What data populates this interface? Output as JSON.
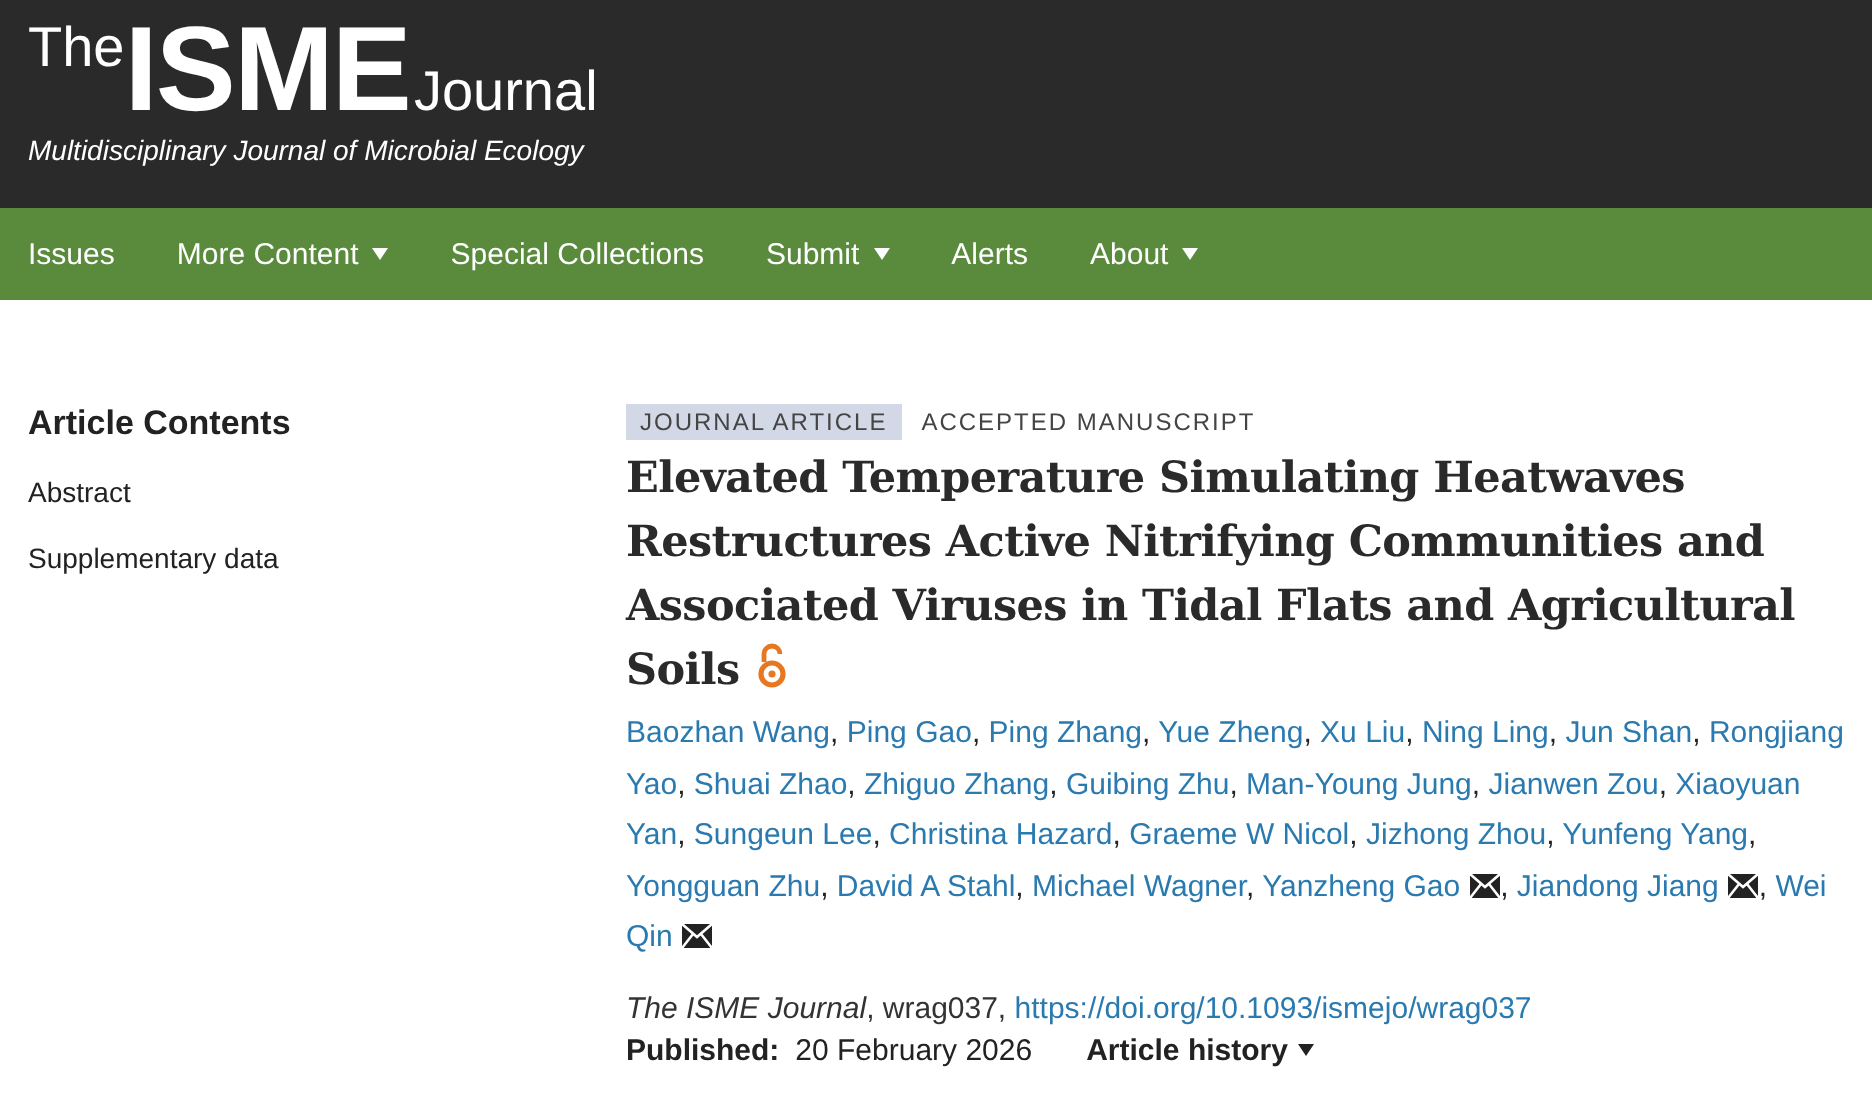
{
  "header": {
    "logo": {
      "prefix": "The",
      "name": "ISME",
      "suffix": "Journal"
    },
    "tagline": "Multidisciplinary Journal of Microbial Ecology"
  },
  "nav": [
    {
      "label": "Issues",
      "dropdown": false
    },
    {
      "label": "More Content",
      "dropdown": true
    },
    {
      "label": "Special Collections",
      "dropdown": false
    },
    {
      "label": "Submit",
      "dropdown": true
    },
    {
      "label": "Alerts",
      "dropdown": false
    },
    {
      "label": "About",
      "dropdown": true
    }
  ],
  "sidebar": {
    "title": "Article Contents",
    "items": [
      "Abstract",
      "Supplementary data"
    ]
  },
  "article": {
    "type": "JOURNAL ARTICLE",
    "status": "ACCEPTED MANUSCRIPT",
    "title": "Elevated Temperature Simulating Heatwaves Restructures Active Nitrifying Communities and Associated Viruses in Tidal Flats and Agricultural Soils",
    "open_access": true,
    "authors": [
      {
        "name": "Baozhan Wang",
        "email": false
      },
      {
        "name": "Ping Gao",
        "email": false
      },
      {
        "name": "Ping Zhang",
        "email": false
      },
      {
        "name": "Yue Zheng",
        "email": false
      },
      {
        "name": "Xu Liu",
        "email": false
      },
      {
        "name": "Ning Ling",
        "email": false
      },
      {
        "name": "Jun Shan",
        "email": false
      },
      {
        "name": "Rongjiang Yao",
        "email": false
      },
      {
        "name": "Shuai Zhao",
        "email": false
      },
      {
        "name": "Zhiguo Zhang",
        "email": false
      },
      {
        "name": "Guibing Zhu",
        "email": false
      },
      {
        "name": "Man-Young Jung",
        "email": false
      },
      {
        "name": "Jianwen Zou",
        "email": false
      },
      {
        "name": "Xiaoyuan Yan",
        "email": false
      },
      {
        "name": "Sungeun Lee",
        "email": false
      },
      {
        "name": "Christina Hazard",
        "email": false
      },
      {
        "name": "Graeme W Nicol",
        "email": false
      },
      {
        "name": "Jizhong Zhou",
        "email": false
      },
      {
        "name": "Yunfeng Yang",
        "email": false
      },
      {
        "name": "Yongguan Zhu",
        "email": false
      },
      {
        "name": "David A Stahl",
        "email": false
      },
      {
        "name": "Michael Wagner",
        "email": false
      },
      {
        "name": "Yanzheng Gao",
        "email": true
      },
      {
        "name": "Jiandong Jiang",
        "email": true
      },
      {
        "name": "Wei Qin",
        "email": true
      }
    ],
    "separator": ",",
    "citation": {
      "journal": "The ISME Journal",
      "id": ", wrag037, ",
      "doi": "https://doi.org/10.1093/ismejo/wrag037"
    },
    "published_label": "Published:",
    "published_date": "20 February 2026",
    "history": {
      "label": "Article history",
      "dropdown": true
    }
  }
}
